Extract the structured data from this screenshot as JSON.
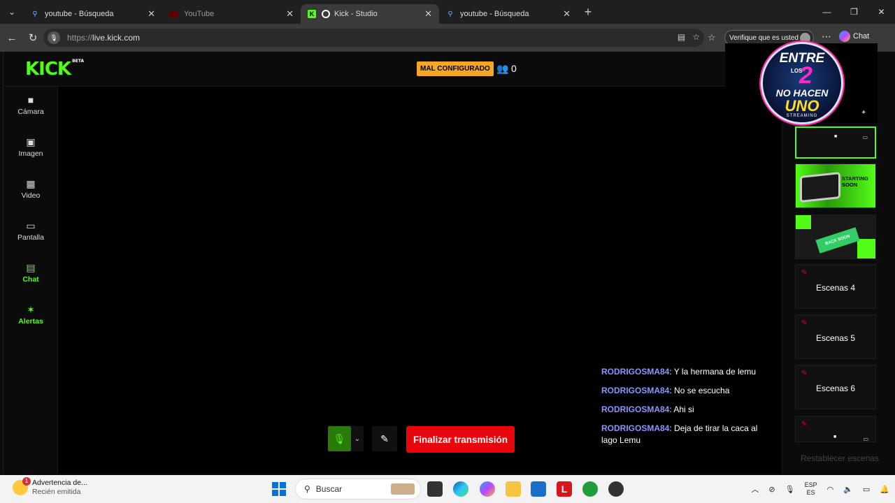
{
  "browser": {
    "tabs": [
      {
        "title": "youtube - Búsqueda",
        "icon": "search-icon",
        "active": false
      },
      {
        "title": "YouTube",
        "icon": "youtube-icon",
        "active": false
      },
      {
        "title": "Kick - Studio",
        "icon": "kick-icon",
        "active": true
      },
      {
        "title": "youtube - Búsqueda",
        "icon": "search-icon",
        "active": false
      }
    ],
    "url_protocol": "https://",
    "url_host": "live.kick.com",
    "verify_label": "Verifique que es usted",
    "copilot_label": "Chat"
  },
  "studio": {
    "logo": "KICK",
    "logo_tag": "BETA",
    "status_badge": "MAL CONFIGURADO",
    "viewer_count": "0",
    "sidebar": [
      {
        "label": "Cámara",
        "icon": "camera-icon"
      },
      {
        "label": "Imagen",
        "icon": "image-icon"
      },
      {
        "label": "Video",
        "icon": "film-icon"
      },
      {
        "label": "Pantalla",
        "icon": "screen-cast-icon"
      },
      {
        "label": "Chat",
        "icon": "chat-icon"
      },
      {
        "label": "Alertas",
        "icon": "party-popper-icon"
      }
    ],
    "end_stream_label": "Finalizar transmisión",
    "chat_messages": [
      {
        "user": "RODRIGOSMA84",
        "text": ": Y la hermana de lemu"
      },
      {
        "user": "RODRIGOSMA84",
        "text": ": No se escucha"
      },
      {
        "user": "RODRIGOSMA84",
        "text": ": Ahi si"
      },
      {
        "user": "RODRIGOSMA84",
        "text": ": Deja de tirar la caca al lago Lemu"
      }
    ],
    "overlay_logo": {
      "line1": "ENTRE",
      "line2": "LOS",
      "two": "2",
      "line3": "NO HACEN",
      "line4": "UNO",
      "line5": "STREAMING"
    },
    "scenes": [
      {
        "name": "",
        "type": "camera"
      },
      {
        "name": "",
        "type": "starting",
        "thumb_text": "STARTING SOON"
      },
      {
        "name": "",
        "type": "back",
        "thumb_text": "BACK SOON"
      },
      {
        "name": "Escenas 4",
        "type": "empty"
      },
      {
        "name": "Escenas 5",
        "type": "empty"
      },
      {
        "name": "Escenas 6",
        "type": "empty"
      },
      {
        "name": "",
        "type": "camera-small"
      }
    ],
    "restore_label": "Restablecer escenas"
  },
  "taskbar": {
    "weather_title": "Advertencia de...",
    "weather_sub": "Recién emitida",
    "search_placeholder": "Buscar",
    "lang_top": "ESP",
    "lang_bottom": "ES"
  },
  "colors": {
    "kick_green": "#53fc18",
    "end_red": "#e8050b",
    "badge_orange": "#f5a623",
    "chat_user": "#8a94ff"
  }
}
